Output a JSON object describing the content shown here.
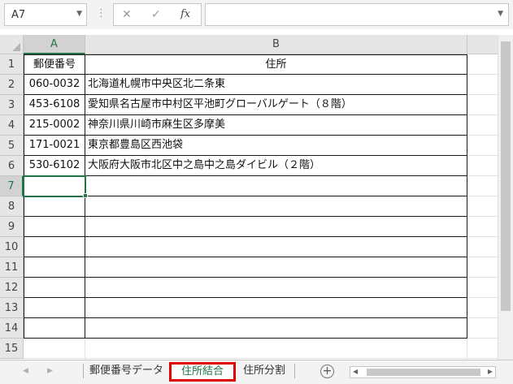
{
  "name_box": {
    "value": "A7"
  },
  "formula_bar": {
    "cancel_icon": "✕",
    "enter_icon": "✓",
    "fx_label": "fx",
    "content": ""
  },
  "columns": [
    "A",
    "B"
  ],
  "rows": [
    "1",
    "2",
    "3",
    "4",
    "5",
    "6",
    "7",
    "8",
    "9",
    "10",
    "11",
    "12",
    "13",
    "14",
    "15"
  ],
  "table": {
    "header": [
      "郵便番号",
      "住所"
    ],
    "data": [
      [
        "060-0032",
        "北海道札幌市中央区北二条東"
      ],
      [
        "453-6108",
        "愛知県名古屋市中村区平池町グローバルゲート（８階）"
      ],
      [
        "215-0002",
        "神奈川県川崎市麻生区多摩美"
      ],
      [
        "171-0021",
        "東京都豊島区西池袋"
      ],
      [
        "530-6102",
        "大阪府大阪市北区中之島中之島ダイビル（２階）"
      ]
    ]
  },
  "sheet_tabs": [
    {
      "label": "郵便番号データ",
      "active": false
    },
    {
      "label": "住所結合",
      "active": true
    },
    {
      "label": "住所分割",
      "active": false
    }
  ],
  "colors": {
    "accent": "#217346",
    "highlight": "#e00000"
  }
}
